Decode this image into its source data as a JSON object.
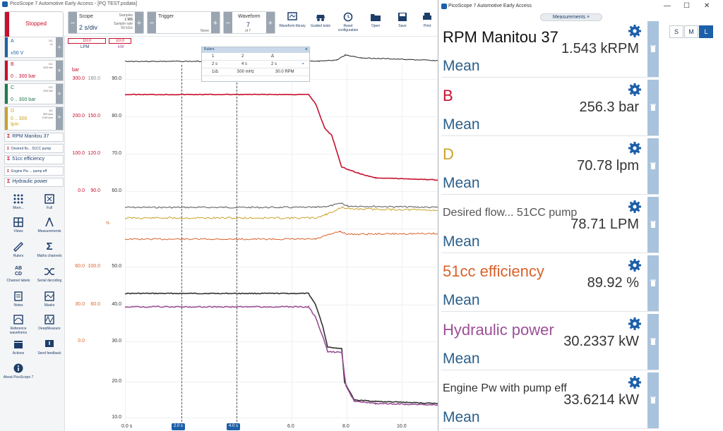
{
  "window": {
    "title": "PicoScope 7 Automotive Early Access - [PQ TEST.psdata]",
    "meas_window_title": "PicoScope 7 Automotive Early Access"
  },
  "toolbar": {
    "status": "Stopped",
    "scope": {
      "label": "Scope",
      "value": "2 s/div",
      "samples_label": "Samples",
      "samples": "1 MS",
      "rate_label": "Sample rate",
      "rate": "50 kS/s"
    },
    "trigger": {
      "label": "Trigger",
      "value": "None"
    },
    "waveform": {
      "label": "Waveform",
      "current": "7",
      "total": "of 7"
    },
    "buttons": [
      "Waveform library",
      "Guided tests",
      "Reset configuration",
      "Open",
      "Save",
      "Print"
    ]
  },
  "channels": [
    {
      "name": "A",
      "coupling": "DC",
      "probe": "x1",
      "range": "±50 V",
      "color": "#1d5fa8"
    },
    {
      "name": "B",
      "coupling": "DC",
      "probe": "600 bar",
      "range": "0 .. 300 bar",
      "color": "#c8102e"
    },
    {
      "name": "C",
      "coupling": "DC",
      "probe": "600 bar",
      "range": "0 .. 300 bar",
      "color": "#1f7a4d"
    },
    {
      "name": "D",
      "coupling": "AC",
      "probe": "300 lpm",
      "range": "0 .. 300",
      "unit": "lpm",
      "extra": "0.55 lpm",
      "color": "#c9a227"
    }
  ],
  "math_channels": [
    "RPM Manitou 37",
    "Desired flo... 51CC pump",
    "51cc efficiency",
    "Engine Pw ... pump eff",
    "Hydraulic power"
  ],
  "tools": [
    "More...",
    "Full",
    "Views",
    "Measurements",
    "Rulers",
    "Maths channels",
    "Channel labels",
    "Serial decoding",
    "Notes",
    "Masks",
    "Reference waveforms",
    "DeepMeasure",
    "Actions",
    "Send feedback",
    "About PicoScope 7"
  ],
  "scale_badges": [
    "10.0",
    "10.0"
  ],
  "axis_units": {
    "lpm": "LPM",
    "kw": "kW",
    "bar": "bar",
    "pct": "%"
  },
  "axis": {
    "col1": [
      "300.0",
      "200.0",
      "100.0",
      "0.0",
      "",
      "60.0",
      "30.0",
      "0.0"
    ],
    "col2": [
      "180.0",
      "150.0",
      "120.0",
      "90.0",
      "",
      "100.0",
      "60.0",
      ""
    ],
    "col3": [
      "90.0",
      "80.0",
      "70.0",
      "60.0",
      "",
      "50.0",
      "40.0",
      "30.0",
      "20.0",
      "10.0"
    ],
    "x": [
      "0.0 s",
      "6.0",
      "8.0",
      "10.0"
    ]
  },
  "markers": [
    "2.0 s",
    "4.0 s"
  ],
  "rulers": {
    "title": "Rulers",
    "header": [
      "1",
      "2",
      "Δ"
    ],
    "row1": [
      "2 s",
      "4 s",
      "2 s"
    ],
    "row2": [
      "1/Δ",
      "500 mHz",
      "30.0 RPM"
    ]
  },
  "meas_tab": "Measurements",
  "measurements": [
    {
      "name": "RPM Manitou 37",
      "value": "1.543 kRPM",
      "stat": "Mean",
      "color": "#111111"
    },
    {
      "name": "B",
      "value": "256.3 bar",
      "stat": "Mean",
      "color": "#c8102e"
    },
    {
      "name": "D",
      "value": "70.78 lpm",
      "stat": "Mean",
      "color": "#c9a227"
    },
    {
      "name": "Desired flow... 51CC pump",
      "value": "78.71 LPM",
      "stat": "Mean",
      "color": "#555555"
    },
    {
      "name": "51cc efficiency",
      "value": "89.92 %",
      "stat": "Mean",
      "color": "#d9622b"
    },
    {
      "name": "Hydraulic power",
      "value": "30.2337 kW",
      "stat": "Mean",
      "color": "#9b4f96"
    },
    {
      "name": "Engine Pw with pump eff",
      "value": "33.6214 kW",
      "stat": "Mean",
      "color": "#333333"
    }
  ],
  "size_buttons": [
    "S",
    "M",
    "L"
  ]
}
